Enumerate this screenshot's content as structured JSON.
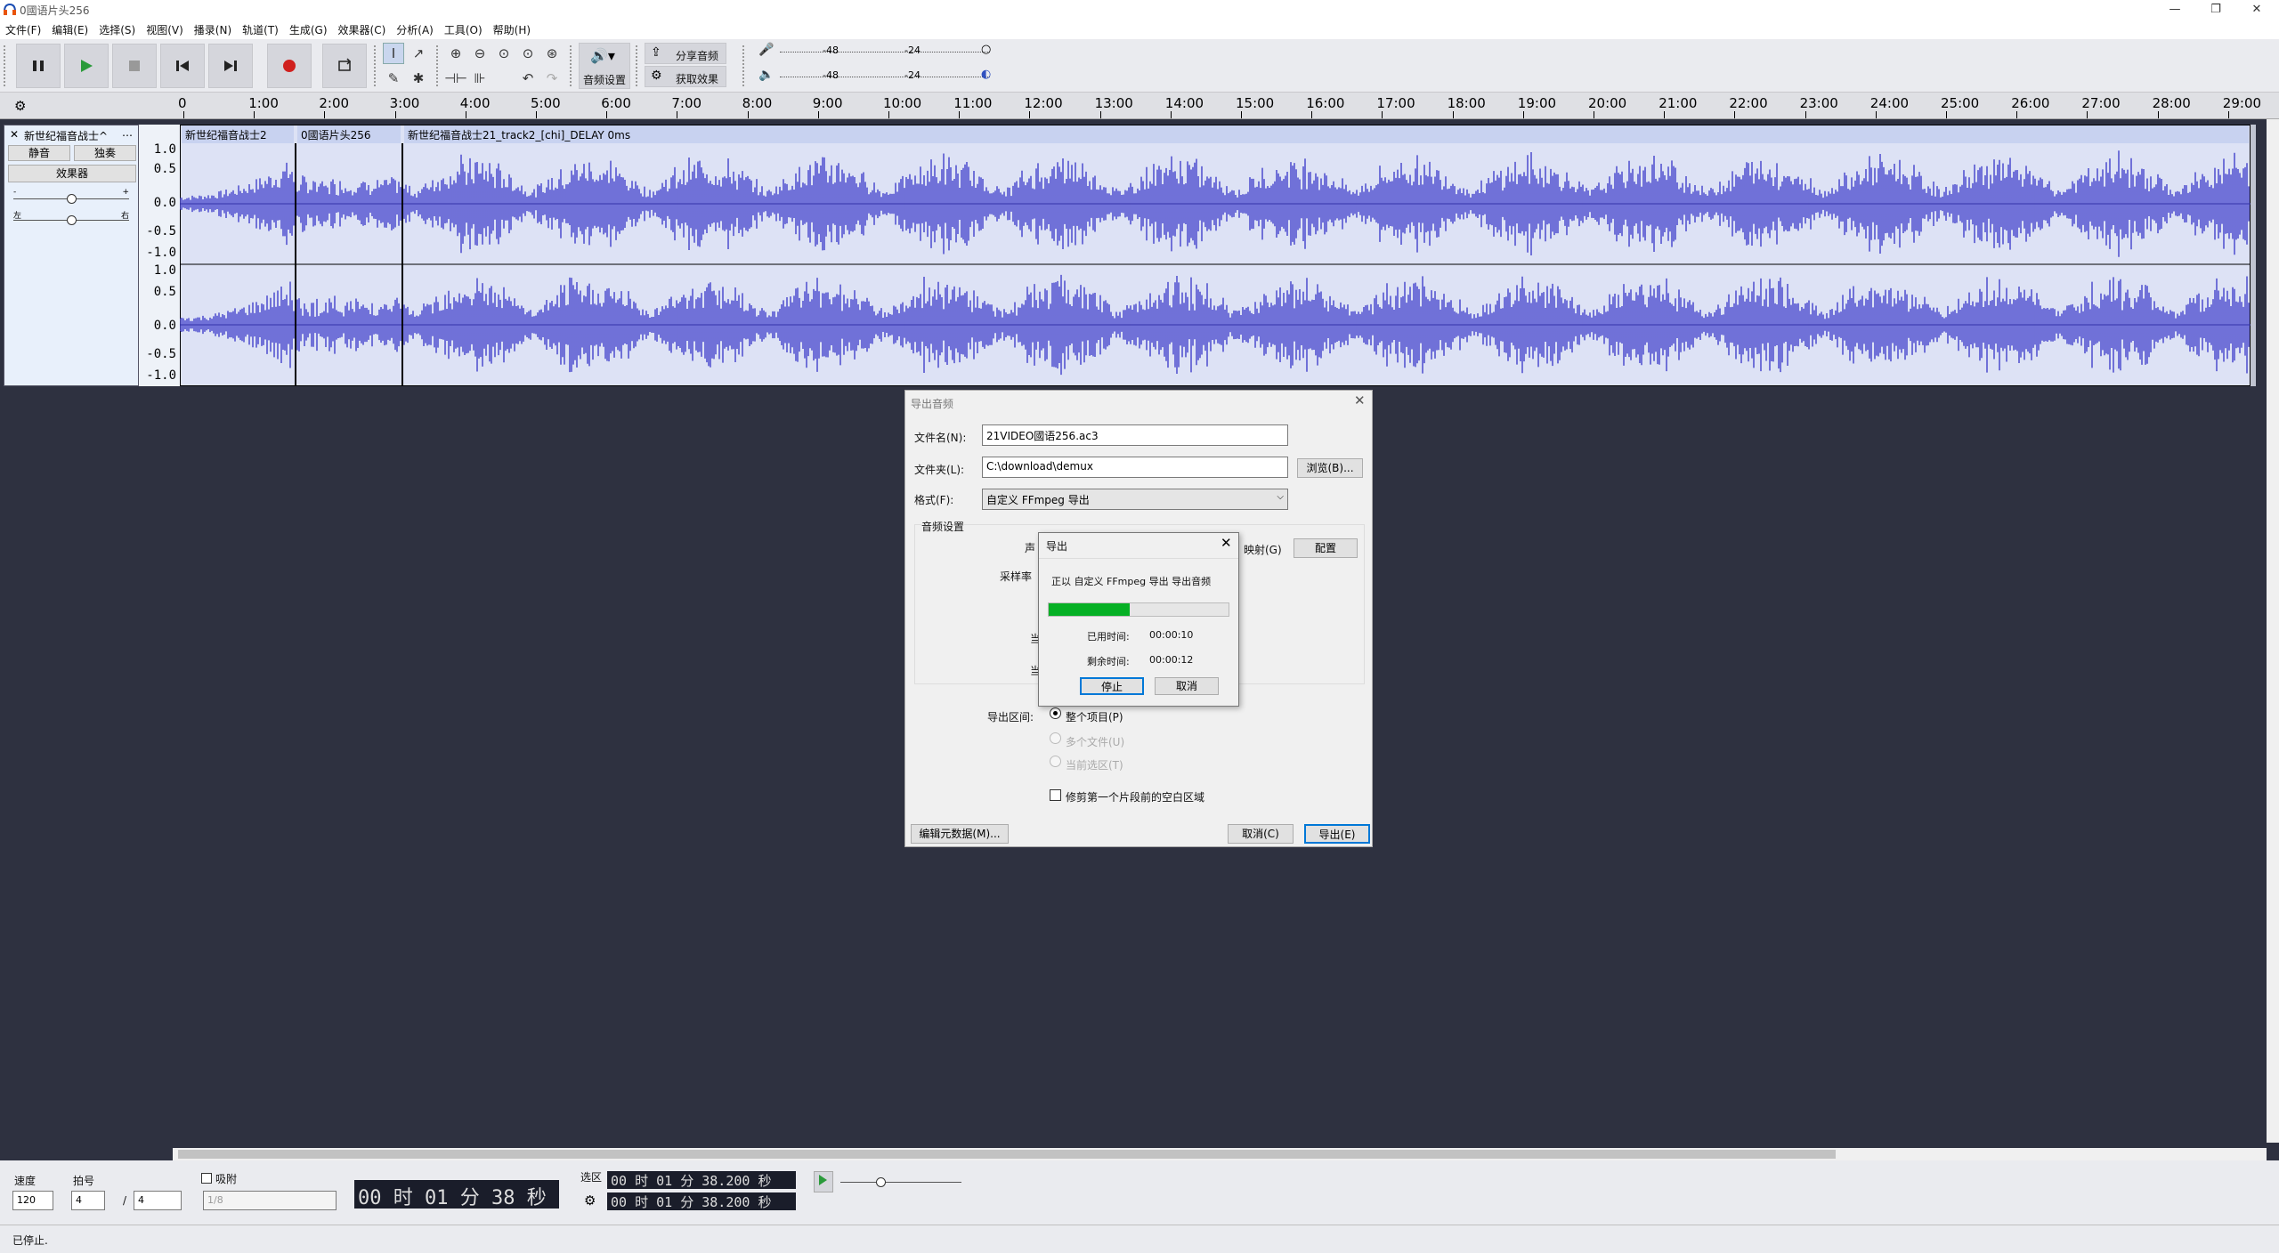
{
  "window": {
    "title": "0國语片头256"
  },
  "menu": [
    "文件(F)",
    "编辑(E)",
    "选择(S)",
    "视图(V)",
    "播录(N)",
    "轨道(T)",
    "生成(G)",
    "效果器(C)",
    "分析(A)",
    "工具(O)",
    "帮助(H)"
  ],
  "toolbar": {
    "audio_settings": "音频设置",
    "share_audio": "分享音频",
    "get_effects": "获取效果",
    "meter_ticks": [
      "-48",
      "-24"
    ]
  },
  "ruler": {
    "ticks": [
      "0",
      "1:00",
      "2:00",
      "3:00",
      "4:00",
      "5:00",
      "6:00",
      "7:00",
      "8:00",
      "9:00",
      "10:00",
      "11:00",
      "12:00",
      "13:00",
      "14:00",
      "15:00",
      "16:00",
      "17:00",
      "18:00",
      "19:00",
      "20:00",
      "21:00",
      "22:00",
      "23:00",
      "24:00",
      "25:00",
      "26:00",
      "27:00",
      "28:00",
      "29:00"
    ]
  },
  "track": {
    "name": "新世纪福音战士^",
    "mute": "静音",
    "solo": "独奏",
    "effects": "效果器",
    "left": "左",
    "right": "右",
    "scale": [
      "1.0",
      "0.5",
      "0.0",
      "-0.5",
      "-1.0"
    ]
  },
  "clips": [
    {
      "name": "新世纪福音战士2"
    },
    {
      "name": "0國语片头256"
    },
    {
      "name": "新世纪福音战士21_track2_[chi]_DELAY 0ms"
    }
  ],
  "export_dialog": {
    "title": "导出音频",
    "filename_label": "文件名(N):",
    "filename_value": "21VIDEO國语256.ac3",
    "folder_label": "文件夹(L):",
    "folder_value": "C:\\download\\demux",
    "browse": "浏览(B)...",
    "format_label": "格式(F):",
    "format_value": "自定义 FFmpeg 导出",
    "audio_settings": "音频设置",
    "channels_label": "声",
    "mapping_label": "映射(G)",
    "configure": "配置",
    "samplerate_label": "采样率",
    "row3_label": "当",
    "row4_label": "当",
    "range_label": "导出区间:",
    "range_whole": "整个项目(P)",
    "range_multi": "多个文件(U)",
    "range_selection": "当前选区(T)",
    "trim_label": "修剪第一个片段前的空白区域",
    "edit_metadata": "编辑元数据(M)...",
    "cancel": "取消(C)",
    "export": "导出(E)"
  },
  "progress": {
    "title": "导出",
    "message": "正以 自定义 FFmpeg 导出 导出音频",
    "elapsed_label": "已用时间:",
    "elapsed_value": "00:00:10",
    "remaining_label": "剩余时间:",
    "remaining_value": "00:00:12",
    "stop": "停止",
    "cancel": "取消",
    "fraction": 0.45
  },
  "bottom": {
    "tempo_label": "速度",
    "tempo_value": "120",
    "beat_label": "拍号",
    "beat_num": "4",
    "beat_slash": "/",
    "beat_den": "4",
    "snap_label": "吸附",
    "snap_value": "1/8",
    "time_display": "00 时 01 分 38 秒",
    "selection_label": "选区",
    "sel_start": "00 时 01 分 38.200 秒",
    "sel_end": "00 时 01 分 38.200 秒"
  },
  "status": {
    "text": "已停止."
  },
  "colors": {
    "wave": "#5555d0",
    "progress": "#06b025",
    "background": "#2e3140"
  }
}
